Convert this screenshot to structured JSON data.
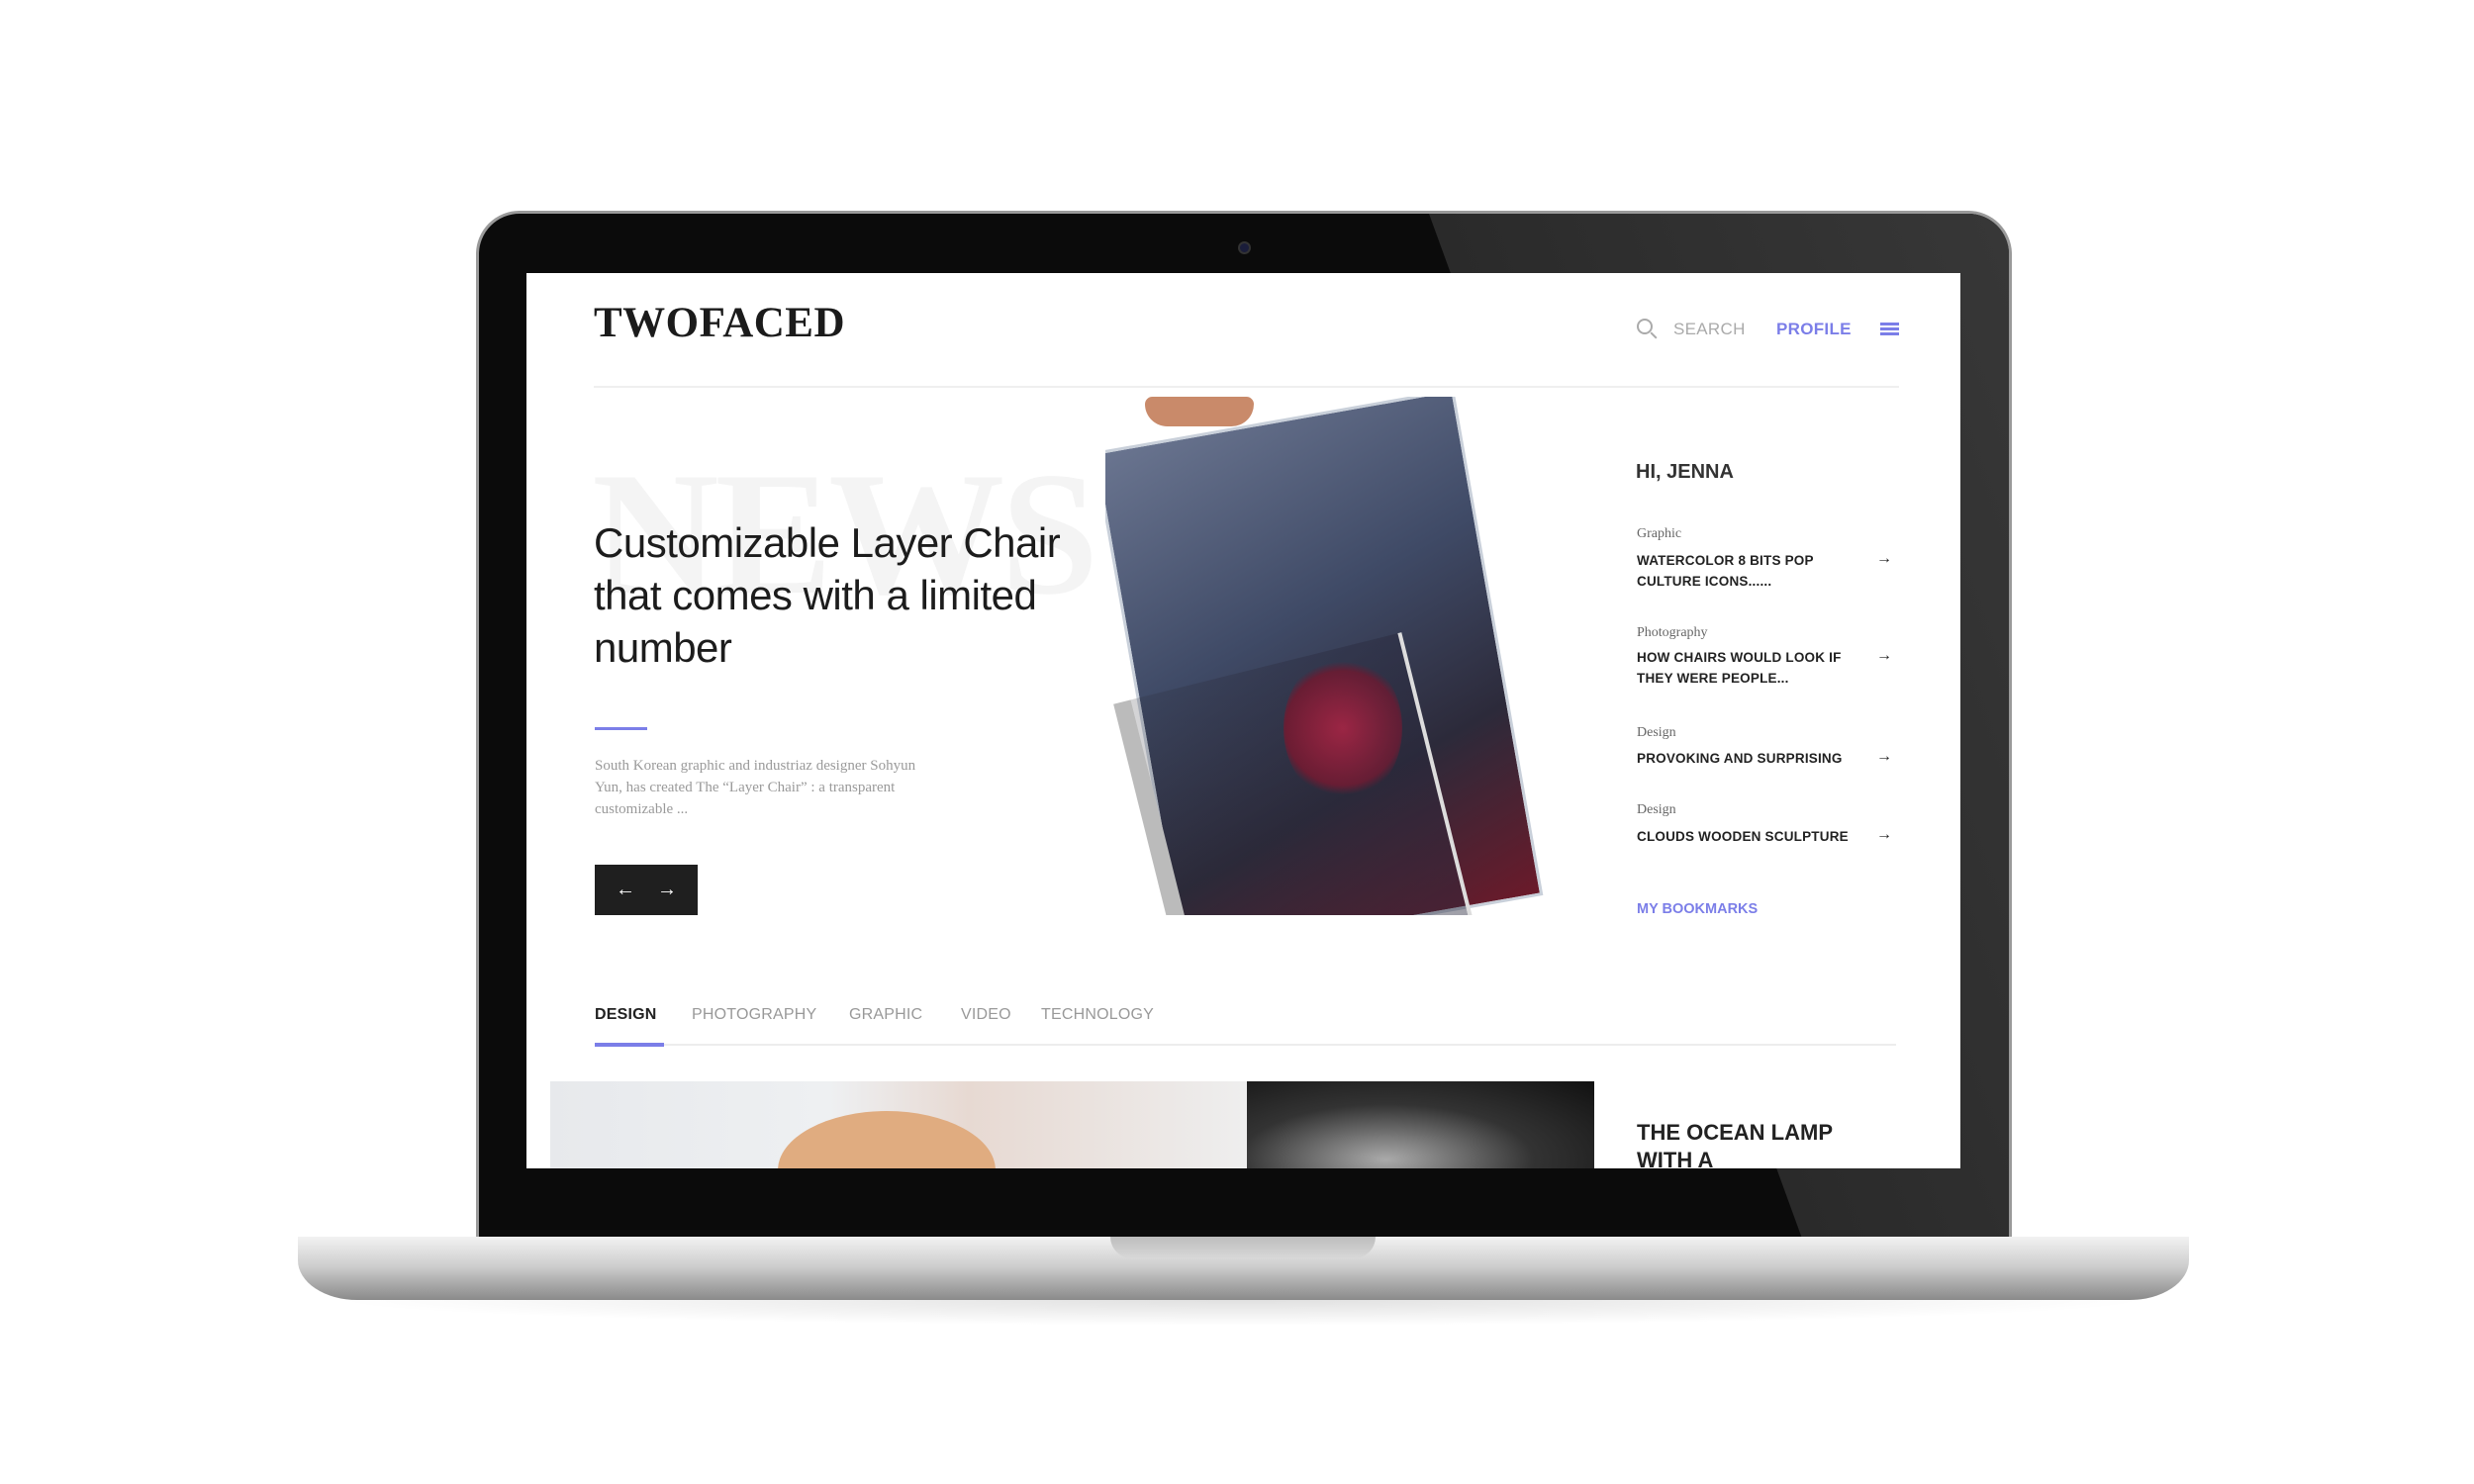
{
  "header": {
    "logo": "TWOFACED",
    "search_label": "SEARCH",
    "profile_label": "PROFILE",
    "accent_color": "#7b7ee8"
  },
  "hero": {
    "watermark": "NEWS",
    "headline": "Customizable Layer Chair that comes with a limited number",
    "excerpt": "South Korean graphic and industriaz designer Sohyun Yun, has created The “Layer Chair” : a transparent customizable ...",
    "prev_icon": "←",
    "next_icon": "→"
  },
  "sidebar": {
    "greeting": "HI, JENNA",
    "items": [
      {
        "category": "Graphic",
        "title": "WATERCOLOR 8 BITS POP CULTURE ICONS......"
      },
      {
        "category": "Photography",
        "title": "HOW CHAIRS WOULD LOOK IF THEY WERE PEOPLE..."
      },
      {
        "category": "Design",
        "title": "PROVOKING AND SURPRISING"
      },
      {
        "category": "Design",
        "title": "CLOUDS WOODEN SCULPTURE"
      }
    ],
    "arrow": "→",
    "bookmarks": "MY BOOKMARKS"
  },
  "tabs": [
    {
      "label": "DESIGN",
      "active": true
    },
    {
      "label": "PHOTOGRAPHY"
    },
    {
      "label": "GRAPHIC"
    },
    {
      "label": "VIDEO"
    },
    {
      "label": "TECHNOLOGY"
    }
  ],
  "feature": {
    "title": "THE OCEAN LAMP WITH A BEAUTIFUL"
  }
}
